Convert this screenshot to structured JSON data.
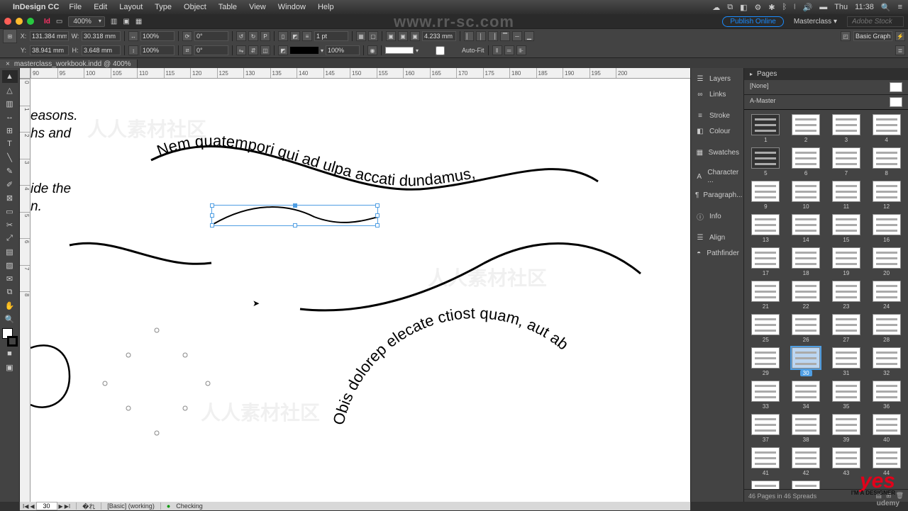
{
  "mac": {
    "app": "InDesign CC",
    "menus": [
      "File",
      "Edit",
      "Layout",
      "Type",
      "Object",
      "Table",
      "View",
      "Window",
      "Help"
    ],
    "clock_day": "Thu",
    "clock_time": "11:38"
  },
  "appbar": {
    "zoom": "400%",
    "publish": "Publish Online",
    "workspace": "Masterclass",
    "search_placeholder": "Adobe Stock"
  },
  "control": {
    "x": "131.384 mm",
    "y": "38.941 mm",
    "w": "30.318 mm",
    "h": "3.648 mm",
    "scale_x": "100%",
    "scale_y": "100%",
    "rotate": "0°",
    "shear": "0°",
    "stroke_pt": "1 pt",
    "opacity": "100%",
    "gap": "4.233 mm",
    "autofit": "Auto-Fit",
    "style_select": "Basic Graphics Frame"
  },
  "doc_tab": {
    "title": "masterclass_workbook.indd @ 400%"
  },
  "ruler_h": [
    "90",
    "95",
    "100",
    "105",
    "110",
    "115",
    "120",
    "125",
    "130",
    "135",
    "140",
    "145",
    "150",
    "155",
    "160",
    "165",
    "170",
    "175",
    "180",
    "185",
    "190",
    "195",
    "200"
  ],
  "ruler_v": [
    "0",
    "1",
    "2",
    "3",
    "4",
    "5",
    "6",
    "7",
    "8"
  ],
  "canvas": {
    "edge_text1": "easons.",
    "edge_text2": "hs and",
    "edge_text3": "ide the",
    "edge_text4": "n.",
    "path_text_top": "Nem quatempori qui ad ulpa accati dundamus,",
    "path_text_bottom": "Obis dolorep elecate ctiost quam, aut ab"
  },
  "panel_rail": [
    "Layers",
    "Links",
    "Stroke",
    "Colour",
    "Swatches",
    "Character ...",
    "Paragraph...",
    "Info",
    "Align",
    "Pathfinder"
  ],
  "pages": {
    "title": "Pages",
    "none": "[None]",
    "amaster": "A-Master",
    "count": 46,
    "selected": 30,
    "footer": "46 Pages in 46 Spreads"
  },
  "status": {
    "page": "30",
    "preset": "[Basic] (working)",
    "preflight": "Checking"
  },
  "watermark_url": "www.rr-sc.com",
  "brand_yes": "yes",
  "brand_yes_sub": "I'M A DESIGNER",
  "brand_u": "udemy"
}
